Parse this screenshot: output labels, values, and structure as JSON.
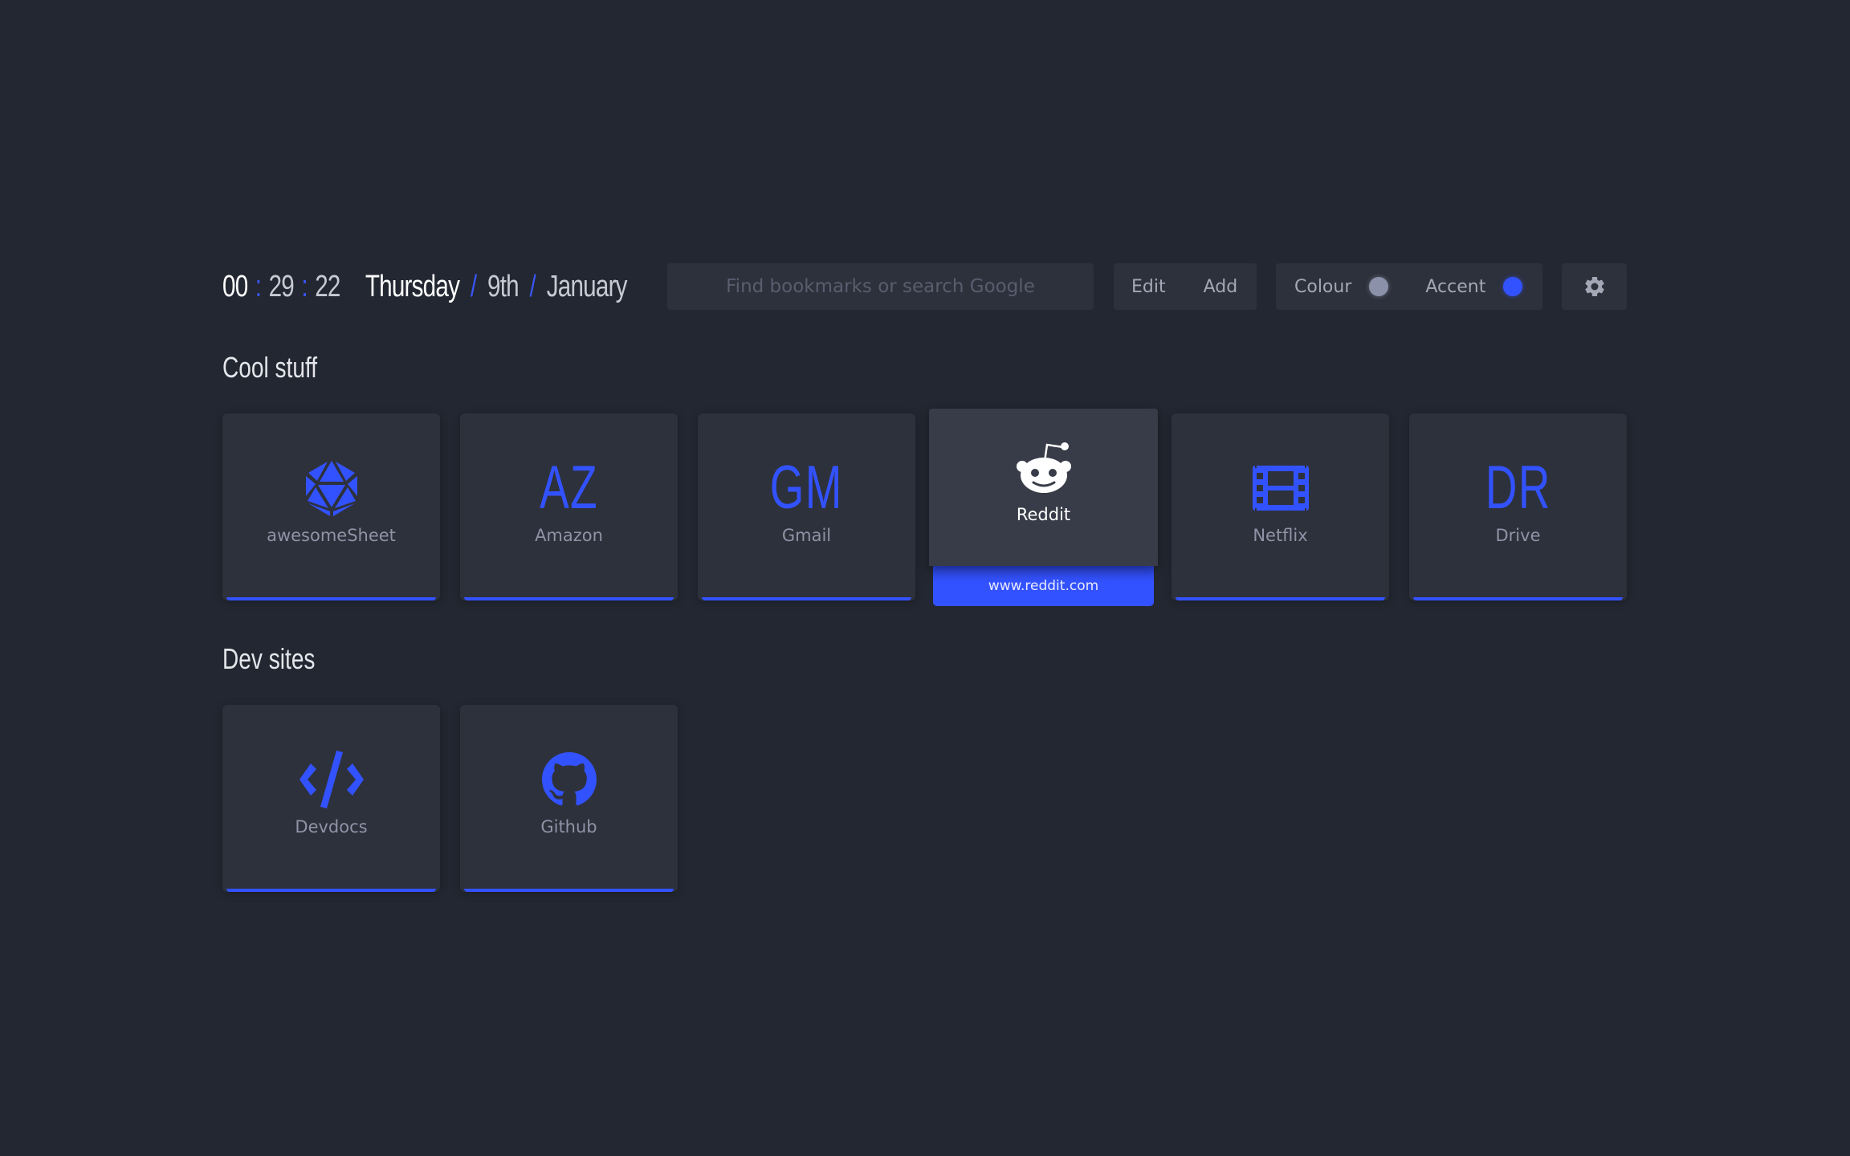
{
  "clock": {
    "hours": "00",
    "minutes": "29",
    "seconds": "22",
    "separator": ":",
    "day": "Thursday",
    "date": "9th",
    "month": "January",
    "date_separator": "/"
  },
  "search": {
    "placeholder": "Find bookmarks or search Google",
    "value": ""
  },
  "toolbar": {
    "edit_label": "Edit",
    "add_label": "Add"
  },
  "theme": {
    "colour_label": "Colour",
    "accent_label": "Accent",
    "colour_value": "#8b91a8",
    "accent_value": "#3352ff"
  },
  "settings": {
    "icon": "gear-icon"
  },
  "colors": {
    "background": "#232731",
    "tile": "#2d313c",
    "tile_hover": "#383c48",
    "accent": "#3352ff",
    "text_muted": "#8e94a6"
  },
  "groups": [
    {
      "title": "Cool stuff",
      "bookmarks": [
        {
          "name": "awesomeSheet",
          "icon": "d20-icon",
          "letters": ""
        },
        {
          "name": "Amazon",
          "icon": "",
          "letters": "AZ"
        },
        {
          "name": "Gmail",
          "icon": "",
          "letters": "GM"
        },
        {
          "name": "Reddit",
          "icon": "reddit-icon",
          "letters": "",
          "url": "www.reddit.com",
          "hovered": true
        },
        {
          "name": "Netflix",
          "icon": "film-icon",
          "letters": ""
        },
        {
          "name": "Drive",
          "icon": "",
          "letters": "DR"
        }
      ]
    },
    {
      "title": "Dev sites",
      "bookmarks": [
        {
          "name": "Devdocs",
          "icon": "code-icon",
          "letters": ""
        },
        {
          "name": "Github",
          "icon": "github-icon",
          "letters": ""
        }
      ]
    }
  ]
}
